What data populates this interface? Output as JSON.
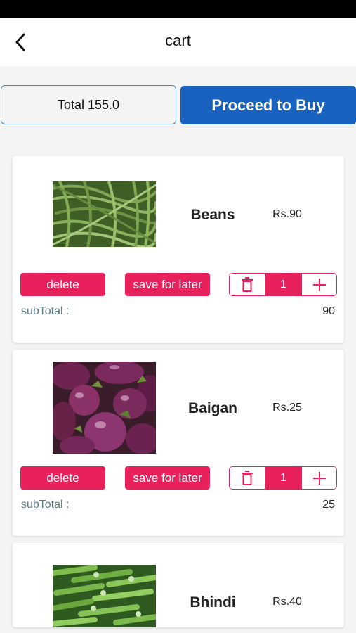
{
  "header": {
    "title": "cart",
    "back_icon": "back-arrow-icon"
  },
  "summary": {
    "total_label": "Total 155.0",
    "proceed_label": "Proceed to Buy"
  },
  "colors": {
    "primary": "#1a62bf",
    "accent": "#e8215d",
    "subtotal_label": "#5a7b86"
  },
  "cart": {
    "items": [
      {
        "name": "Beans",
        "price": "Rs.90",
        "image": "green-beans-photo",
        "delete_label": "delete",
        "save_label": "save for later",
        "quantity": "1",
        "subtotal_label": "subTotal :",
        "subtotal_value": "90"
      },
      {
        "name": "Baigan",
        "price": "Rs.25",
        "image": "eggplant-photo",
        "delete_label": "delete",
        "save_label": "save for later",
        "quantity": "1",
        "subtotal_label": "subTotal :",
        "subtotal_value": "25"
      },
      {
        "name": "Bhindi",
        "price": "Rs.40",
        "image": "okra-photo"
      }
    ]
  }
}
